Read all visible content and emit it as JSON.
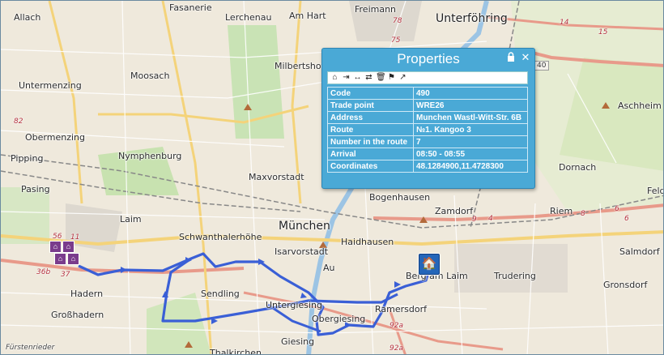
{
  "map": {
    "places": [
      "Allach",
      "Fasanerie",
      "Lerchenau",
      "Am Hart",
      "Freimann",
      "Unterföhring",
      "Moosach",
      "Milbertshofen",
      "Untermenzing",
      "Obermenzing",
      "Nymphenburg",
      "Pipping",
      "Pasing",
      "Maxvorstadt",
      "Bogenhausen",
      "Zamdorf",
      "München",
      "Haidhausen",
      "Laim",
      "Schwanthalerhöhe",
      "Isarvorstadt",
      "Au",
      "Berg am Laim",
      "Trudering",
      "Riem",
      "Dornach",
      "Aschheim",
      "Feldk",
      "Salmdorf",
      "Gronsdorf",
      "Hadern",
      "Sendling",
      "Untergiesing",
      "Ramersdorf",
      "Obergiesing",
      "Großhadern",
      "Giesing",
      "Thalkirchen",
      "Fürstenrieder"
    ],
    "road_labels": [
      "82",
      "36b",
      "37",
      "40",
      "14",
      "78",
      "75",
      "92a",
      "92a",
      "8",
      "6",
      "6",
      "4",
      "9",
      "15"
    ]
  },
  "popup": {
    "title": "Properties",
    "lock_icon": "lock-icon",
    "close_icon": "close-icon",
    "toolbar": [
      "home-icon",
      "arrow-right-bar-icon",
      "arrows-horizontal-icon",
      "swap-icon",
      "trash-icon",
      "flag-icon",
      "external-link-icon"
    ],
    "rows": [
      {
        "key": "Code",
        "value": "490"
      },
      {
        "key": "Trade point",
        "value": "WRE26"
      },
      {
        "key": "Address",
        "value": "Munchen Wastl-Witt-Str. 6B"
      },
      {
        "key": "Route",
        "value": "№1. Kangoo 3"
      },
      {
        "key": "Number in the route",
        "value": "7"
      },
      {
        "key": "Arrival",
        "value": "08:50 - 08:55"
      },
      {
        "key": "Coordinates",
        "value": "48.1284900,11.4728300"
      }
    ]
  },
  "markers": {
    "depot_icon": "warehouse-icon",
    "cluster_labels": [
      "56",
      "11",
      "37"
    ]
  },
  "colors": {
    "route": "#3a5fd6",
    "popup": "#4aa9d6",
    "depot": "#2466b9",
    "cluster": "#7a3c8c"
  }
}
